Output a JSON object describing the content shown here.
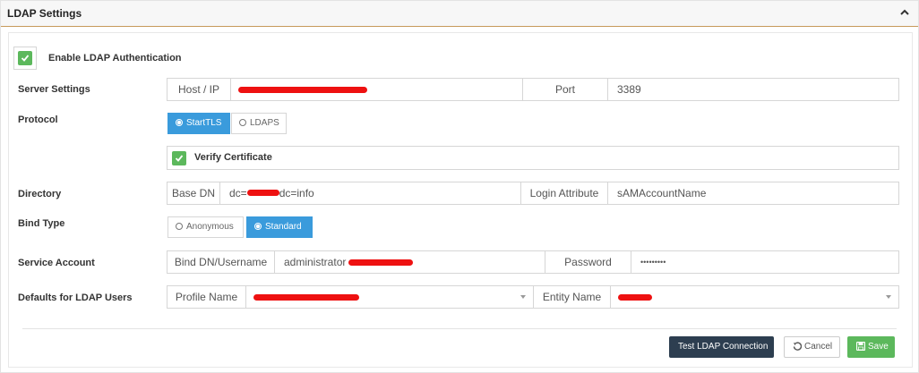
{
  "panel": {
    "title": "LDAP Settings"
  },
  "enable": {
    "label": "Enable LDAP Authentication",
    "checked": true
  },
  "server": {
    "label": "Server Settings",
    "host_addon": "Host / IP",
    "host_value": "",
    "port_addon": "Port",
    "port_value": "3389"
  },
  "protocol": {
    "label": "Protocol",
    "options": [
      "StartTLS",
      "LDAPS"
    ],
    "selected": "StartTLS",
    "verify_label": "Verify Certificate",
    "verify_checked": true
  },
  "directory": {
    "label": "Directory",
    "base_dn_addon": "Base DN",
    "base_dn_prefix": "dc=",
    "base_dn_suffix": "dc=info",
    "login_attr_addon": "Login Attribute",
    "login_attr_value": "sAMAccountName"
  },
  "bind": {
    "label": "Bind Type",
    "options": [
      "Anonymous",
      "Standard"
    ],
    "selected": "Standard"
  },
  "service": {
    "label": "Service Account",
    "bind_dn_addon": "Bind DN/Username",
    "bind_dn_value": "administrator",
    "password_addon": "Password",
    "password_value": "•••••••••"
  },
  "defaults": {
    "label": "Defaults for LDAP Users",
    "profile_addon": "Profile Name",
    "entity_addon": "Entity Name"
  },
  "actions": {
    "test": "Test LDAP Connection",
    "cancel": "Cancel",
    "save": "Save"
  },
  "colors": {
    "primary": "#3a9bdc",
    "success": "#5cb85c",
    "dark": "#2d3e50",
    "redaction": "#ee1111",
    "header_border": "#c79a5a"
  }
}
